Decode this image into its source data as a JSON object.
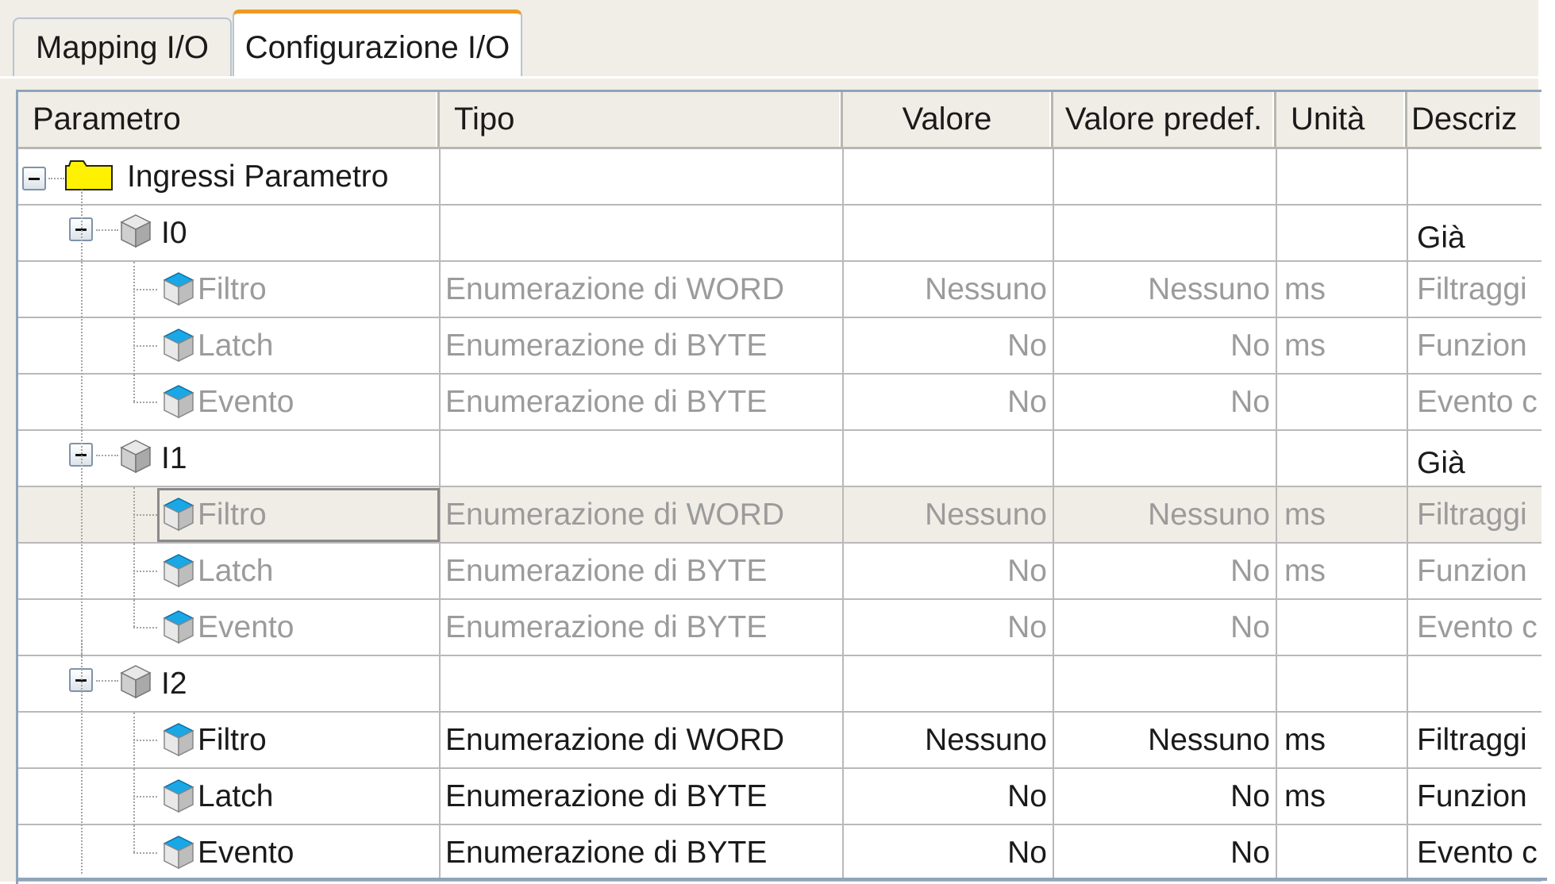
{
  "tabs": [
    {
      "label": "Mapping I/O",
      "active": false
    },
    {
      "label": "Configurazione I/O",
      "active": true
    }
  ],
  "columns": {
    "parametro": "Parametro",
    "tipo": "Tipo",
    "valore": "Valore",
    "valore_predef": "Valore predef.",
    "unita": "Unità",
    "descrizione": "Descriz"
  },
  "tree": {
    "root": {
      "label": "Ingressi Parametro",
      "icon": "folder-icon"
    },
    "groups": [
      {
        "label": "I0",
        "icon": "module-icon",
        "descr": "Già",
        "params": [
          {
            "name": "Filtro",
            "tipo": "Enumerazione di WORD",
            "valore": "Nessuno",
            "predef": "Nessuno",
            "unita": "ms",
            "descr": "Filtraggi"
          },
          {
            "name": "Latch",
            "tipo": "Enumerazione di BYTE",
            "valore": "No",
            "predef": "No",
            "unita": "ms",
            "descr": "Funzion"
          },
          {
            "name": "Evento",
            "tipo": "Enumerazione di BYTE",
            "valore": "No",
            "predef": "No",
            "unita": "",
            "descr": "Evento c"
          }
        ]
      },
      {
        "label": "I1",
        "icon": "module-icon",
        "descr": "Già",
        "params": [
          {
            "name": "Filtro",
            "tipo": "Enumerazione di WORD",
            "valore": "Nessuno",
            "predef": "Nessuno",
            "unita": "ms",
            "descr": "Filtraggi"
          },
          {
            "name": "Latch",
            "tipo": "Enumerazione di BYTE",
            "valore": "No",
            "predef": "No",
            "unita": "ms",
            "descr": "Funzion"
          },
          {
            "name": "Evento",
            "tipo": "Enumerazione di BYTE",
            "valore": "No",
            "predef": "No",
            "unita": "",
            "descr": "Evento c"
          }
        ]
      },
      {
        "label": "I2",
        "icon": "module-icon",
        "descr": "",
        "params": [
          {
            "name": "Filtro",
            "tipo": "Enumerazione di WORD",
            "valore": "Nessuno",
            "predef": "Nessuno",
            "unita": "ms",
            "descr": "Filtraggi"
          },
          {
            "name": "Latch",
            "tipo": "Enumerazione di BYTE",
            "valore": "No",
            "predef": "No",
            "unita": "ms",
            "descr": "Funzion"
          },
          {
            "name": "Evento",
            "tipo": "Enumerazione di BYTE",
            "valore": "No",
            "predef": "No",
            "unita": "",
            "descr": "Evento c"
          }
        ]
      }
    ]
  },
  "colors": {
    "tab_accent": "#ef9a1f",
    "folder": "#fff200",
    "param_icon": "#1aa7e6",
    "disabled_text": "#9b9b9b",
    "selected_row": "#f0ede6"
  }
}
